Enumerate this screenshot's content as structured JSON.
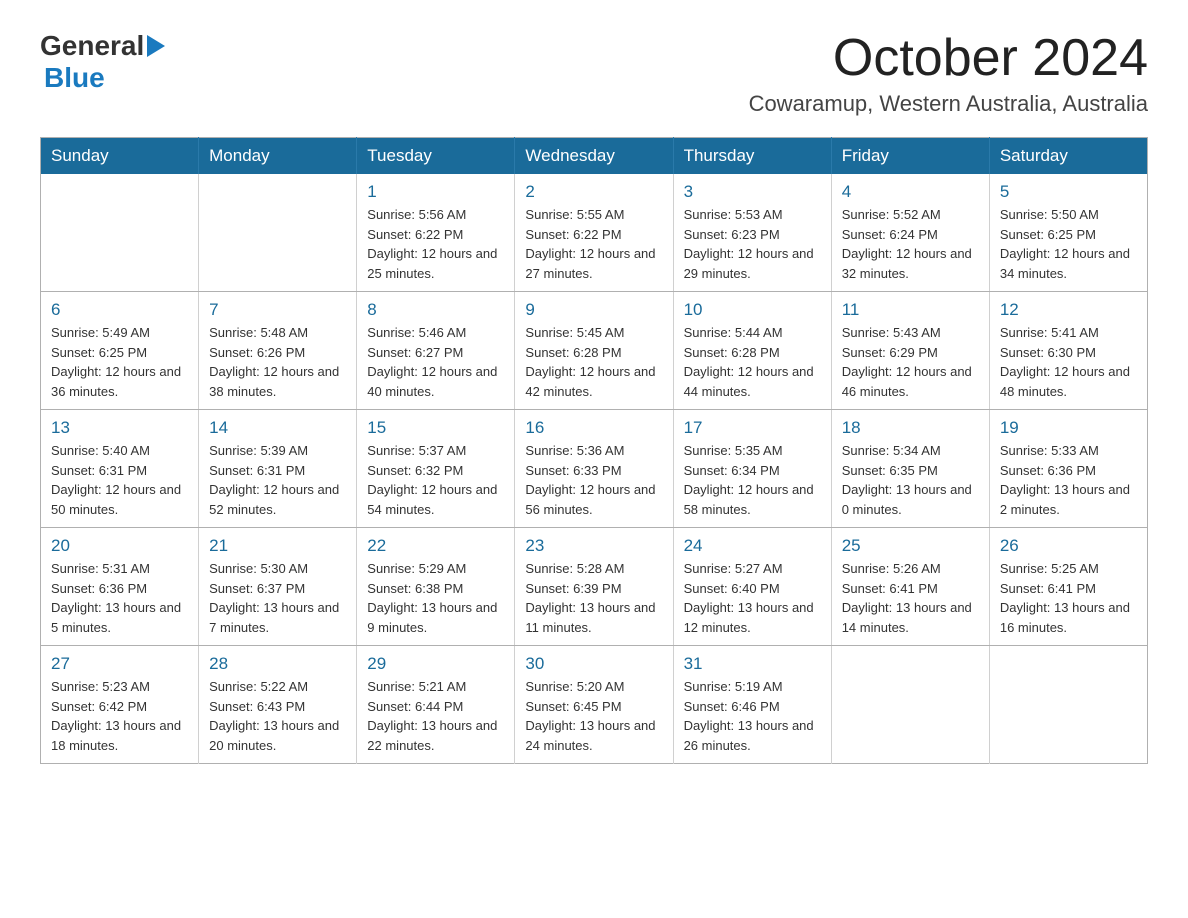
{
  "header": {
    "logo_general": "General",
    "logo_blue": "Blue",
    "month_title": "October 2024",
    "location": "Cowaramup, Western Australia, Australia"
  },
  "weekdays": [
    "Sunday",
    "Monday",
    "Tuesday",
    "Wednesday",
    "Thursday",
    "Friday",
    "Saturday"
  ],
  "weeks": [
    [
      {
        "day": "",
        "sunrise": "",
        "sunset": "",
        "daylight": ""
      },
      {
        "day": "",
        "sunrise": "",
        "sunset": "",
        "daylight": ""
      },
      {
        "day": "1",
        "sunrise": "Sunrise: 5:56 AM",
        "sunset": "Sunset: 6:22 PM",
        "daylight": "Daylight: 12 hours and 25 minutes."
      },
      {
        "day": "2",
        "sunrise": "Sunrise: 5:55 AM",
        "sunset": "Sunset: 6:22 PM",
        "daylight": "Daylight: 12 hours and 27 minutes."
      },
      {
        "day": "3",
        "sunrise": "Sunrise: 5:53 AM",
        "sunset": "Sunset: 6:23 PM",
        "daylight": "Daylight: 12 hours and 29 minutes."
      },
      {
        "day": "4",
        "sunrise": "Sunrise: 5:52 AM",
        "sunset": "Sunset: 6:24 PM",
        "daylight": "Daylight: 12 hours and 32 minutes."
      },
      {
        "day": "5",
        "sunrise": "Sunrise: 5:50 AM",
        "sunset": "Sunset: 6:25 PM",
        "daylight": "Daylight: 12 hours and 34 minutes."
      }
    ],
    [
      {
        "day": "6",
        "sunrise": "Sunrise: 5:49 AM",
        "sunset": "Sunset: 6:25 PM",
        "daylight": "Daylight: 12 hours and 36 minutes."
      },
      {
        "day": "7",
        "sunrise": "Sunrise: 5:48 AM",
        "sunset": "Sunset: 6:26 PM",
        "daylight": "Daylight: 12 hours and 38 minutes."
      },
      {
        "day": "8",
        "sunrise": "Sunrise: 5:46 AM",
        "sunset": "Sunset: 6:27 PM",
        "daylight": "Daylight: 12 hours and 40 minutes."
      },
      {
        "day": "9",
        "sunrise": "Sunrise: 5:45 AM",
        "sunset": "Sunset: 6:28 PM",
        "daylight": "Daylight: 12 hours and 42 minutes."
      },
      {
        "day": "10",
        "sunrise": "Sunrise: 5:44 AM",
        "sunset": "Sunset: 6:28 PM",
        "daylight": "Daylight: 12 hours and 44 minutes."
      },
      {
        "day": "11",
        "sunrise": "Sunrise: 5:43 AM",
        "sunset": "Sunset: 6:29 PM",
        "daylight": "Daylight: 12 hours and 46 minutes."
      },
      {
        "day": "12",
        "sunrise": "Sunrise: 5:41 AM",
        "sunset": "Sunset: 6:30 PM",
        "daylight": "Daylight: 12 hours and 48 minutes."
      }
    ],
    [
      {
        "day": "13",
        "sunrise": "Sunrise: 5:40 AM",
        "sunset": "Sunset: 6:31 PM",
        "daylight": "Daylight: 12 hours and 50 minutes."
      },
      {
        "day": "14",
        "sunrise": "Sunrise: 5:39 AM",
        "sunset": "Sunset: 6:31 PM",
        "daylight": "Daylight: 12 hours and 52 minutes."
      },
      {
        "day": "15",
        "sunrise": "Sunrise: 5:37 AM",
        "sunset": "Sunset: 6:32 PM",
        "daylight": "Daylight: 12 hours and 54 minutes."
      },
      {
        "day": "16",
        "sunrise": "Sunrise: 5:36 AM",
        "sunset": "Sunset: 6:33 PM",
        "daylight": "Daylight: 12 hours and 56 minutes."
      },
      {
        "day": "17",
        "sunrise": "Sunrise: 5:35 AM",
        "sunset": "Sunset: 6:34 PM",
        "daylight": "Daylight: 12 hours and 58 minutes."
      },
      {
        "day": "18",
        "sunrise": "Sunrise: 5:34 AM",
        "sunset": "Sunset: 6:35 PM",
        "daylight": "Daylight: 13 hours and 0 minutes."
      },
      {
        "day": "19",
        "sunrise": "Sunrise: 5:33 AM",
        "sunset": "Sunset: 6:36 PM",
        "daylight": "Daylight: 13 hours and 2 minutes."
      }
    ],
    [
      {
        "day": "20",
        "sunrise": "Sunrise: 5:31 AM",
        "sunset": "Sunset: 6:36 PM",
        "daylight": "Daylight: 13 hours and 5 minutes."
      },
      {
        "day": "21",
        "sunrise": "Sunrise: 5:30 AM",
        "sunset": "Sunset: 6:37 PM",
        "daylight": "Daylight: 13 hours and 7 minutes."
      },
      {
        "day": "22",
        "sunrise": "Sunrise: 5:29 AM",
        "sunset": "Sunset: 6:38 PM",
        "daylight": "Daylight: 13 hours and 9 minutes."
      },
      {
        "day": "23",
        "sunrise": "Sunrise: 5:28 AM",
        "sunset": "Sunset: 6:39 PM",
        "daylight": "Daylight: 13 hours and 11 minutes."
      },
      {
        "day": "24",
        "sunrise": "Sunrise: 5:27 AM",
        "sunset": "Sunset: 6:40 PM",
        "daylight": "Daylight: 13 hours and 12 minutes."
      },
      {
        "day": "25",
        "sunrise": "Sunrise: 5:26 AM",
        "sunset": "Sunset: 6:41 PM",
        "daylight": "Daylight: 13 hours and 14 minutes."
      },
      {
        "day": "26",
        "sunrise": "Sunrise: 5:25 AM",
        "sunset": "Sunset: 6:41 PM",
        "daylight": "Daylight: 13 hours and 16 minutes."
      }
    ],
    [
      {
        "day": "27",
        "sunrise": "Sunrise: 5:23 AM",
        "sunset": "Sunset: 6:42 PM",
        "daylight": "Daylight: 13 hours and 18 minutes."
      },
      {
        "day": "28",
        "sunrise": "Sunrise: 5:22 AM",
        "sunset": "Sunset: 6:43 PM",
        "daylight": "Daylight: 13 hours and 20 minutes."
      },
      {
        "day": "29",
        "sunrise": "Sunrise: 5:21 AM",
        "sunset": "Sunset: 6:44 PM",
        "daylight": "Daylight: 13 hours and 22 minutes."
      },
      {
        "day": "30",
        "sunrise": "Sunrise: 5:20 AM",
        "sunset": "Sunset: 6:45 PM",
        "daylight": "Daylight: 13 hours and 24 minutes."
      },
      {
        "day": "31",
        "sunrise": "Sunrise: 5:19 AM",
        "sunset": "Sunset: 6:46 PM",
        "daylight": "Daylight: 13 hours and 26 minutes."
      },
      {
        "day": "",
        "sunrise": "",
        "sunset": "",
        "daylight": ""
      },
      {
        "day": "",
        "sunrise": "",
        "sunset": "",
        "daylight": ""
      }
    ]
  ]
}
